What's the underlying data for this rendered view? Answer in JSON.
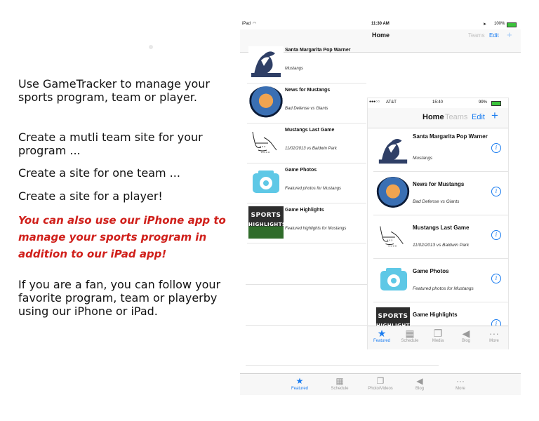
{
  "promo": {
    "p1": "Use GameTracker to manage your sports program, team or player.",
    "p2": "Create a mutli team site for your program ...",
    "p3": "Create a site for one team ...",
    "p4": "Create a site for a player!",
    "p5": "You can also use our iPhone app to manage your sports program in addition to our iPad app!",
    "p6": "If you are a fan, you can follow your favorite program, team or playerby using our iPhone or iPad."
  },
  "ipad": {
    "status": {
      "device": "iPad",
      "time": "11:30 AM",
      "battery": "100%"
    },
    "nav": {
      "title": "Home",
      "teams": "Teams",
      "edit": "Edit",
      "add": "+"
    },
    "rows": [
      {
        "title": "Santa Margarita Pop Warner",
        "subtitle": "Mustangs",
        "icon": "mustang-logo-icon"
      },
      {
        "title": "News for Mustangs",
        "subtitle": "Bad Defense vs Giants",
        "icon": "news-reader-icon"
      },
      {
        "title": "Mustangs Last Game",
        "subtitle": "11/02/2013 vs Baldwin Park",
        "icon": "playbook-icon"
      },
      {
        "title": "Game Photos",
        "subtitle": "Featured photos for Mustangs",
        "icon": "camera-icon"
      },
      {
        "title": "Game Highlights",
        "subtitle": "Featured highlights for Mustangs",
        "icon": "sports-highlights-icon"
      }
    ],
    "tabs": [
      "Featured",
      "Schedule",
      "Photo/Videos",
      "Blog",
      "More"
    ]
  },
  "iphone": {
    "status": {
      "carrier": "AT&T",
      "time": "15:40",
      "battery": "99%"
    },
    "nav": {
      "title": "Home",
      "teams": "Teams",
      "edit": "Edit",
      "add": "+"
    },
    "rows": [
      {
        "title": "Santa Margarita Pop Warner",
        "subtitle": "Mustangs"
      },
      {
        "title": "News for Mustangs",
        "subtitle": "Bad Defense vs Giants"
      },
      {
        "title": "Mustangs Last Game",
        "subtitle": "11/02/2013 vs Baldwin Park"
      },
      {
        "title": "Game Photos",
        "subtitle": "Featured photos for Mustangs"
      },
      {
        "title": "Game Highlights",
        "subtitle": ""
      }
    ],
    "tabs": [
      "Featured",
      "Schedule",
      "Media",
      "Blog",
      "More"
    ]
  },
  "highlights_thumb": {
    "line1": "SPORTS",
    "line2": "HIGHLIGHTS"
  },
  "colors": {
    "accent": "#1a7cf0",
    "promo_red": "#d0201b"
  }
}
